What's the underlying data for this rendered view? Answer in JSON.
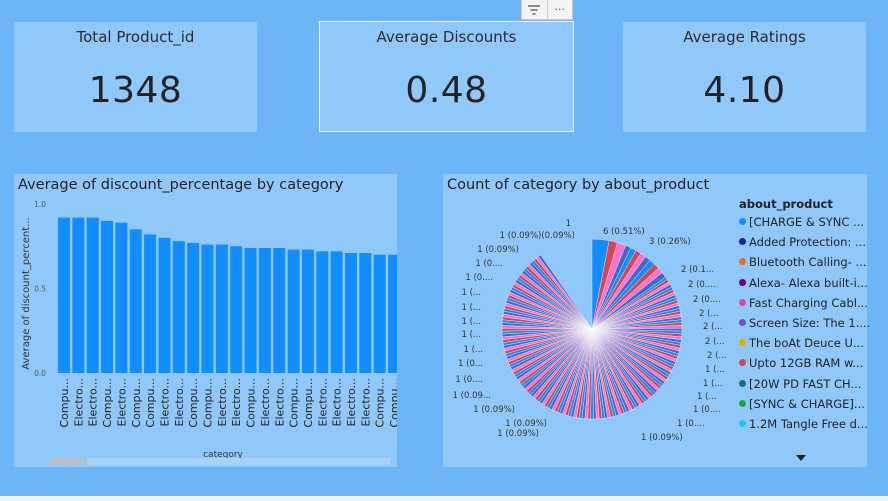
{
  "kpis": {
    "total": {
      "title": "Total Product_id",
      "value": "1348"
    },
    "discounts": {
      "title": "Average Discounts",
      "value": "0.48"
    },
    "ratings": {
      "title": "Average Ratings",
      "value": "4.10"
    }
  },
  "toolbar": {
    "filter_icon": "filter-icon",
    "more_icon": "more-options-icon",
    "more_glyph": "···"
  },
  "bar_chart": {
    "title": "Average of discount_percentage by category",
    "chart_data": {
      "type": "bar",
      "title": "Average of discount_percentage by category",
      "xlabel": "category",
      "ylabel": "Average of discount_percent...",
      "ylim": [
        0,
        1
      ],
      "yticks": [
        "0.0",
        "0.5",
        "1.0"
      ],
      "categories": [
        "Compu...",
        "Electro...",
        "Electro...",
        "Compu...",
        "Electro...",
        "Compu...",
        "Compu...",
        "Electro...",
        "Electro...",
        "Compu...",
        "Compu...",
        "Electro...",
        "Electro...",
        "Compu...",
        "Electro...",
        "Electro...",
        "Compu...",
        "Compu...",
        "Electro...",
        "Electro...",
        "Electro...",
        "Electro...",
        "Compu...",
        "Compu...",
        "Electro...",
        "Electro..."
      ],
      "values": [
        0.92,
        0.92,
        0.92,
        0.9,
        0.89,
        0.85,
        0.82,
        0.8,
        0.78,
        0.77,
        0.76,
        0.76,
        0.75,
        0.74,
        0.74,
        0.74,
        0.73,
        0.73,
        0.72,
        0.72,
        0.71,
        0.71,
        0.7,
        0.7,
        0.7,
        0.7
      ],
      "color": "#118dff"
    }
  },
  "pie_chart": {
    "title": "Count of category by about_product",
    "chart_data": {
      "type": "pie",
      "title": "Count of category by about_product",
      "legend_title": "about_product",
      "legend": [
        {
          "label": "[CHARGE & SYNC ...",
          "color": "#118dff"
        },
        {
          "label": "Added Protection: ...",
          "color": "#12239e"
        },
        {
          "label": "Bluetooth Calling- ...",
          "color": "#e66c37"
        },
        {
          "label": "Alexa- Alexa built-i...",
          "color": "#6b007b"
        },
        {
          "label": "Fast Charging Cabl...",
          "color": "#e044a7"
        },
        {
          "label": "Screen Size: The 1....",
          "color": "#744ec2"
        },
        {
          "label": "The boAt Deuce U...",
          "color": "#d9b300"
        },
        {
          "label": "Upto 12GB RAM w...",
          "color": "#d64550"
        },
        {
          "label": "[20W PD FAST CH...",
          "color": "#197278"
        },
        {
          "label": "[SYNC & CHARGE]...",
          "color": "#1aab40"
        },
        {
          "label": "1.2M Tangle Free d...",
          "color": "#15c6f4"
        }
      ],
      "data_labels": [
        "1",
        "6 (0.51%)",
        "3 (0.26%)",
        "2 (0.1...",
        "2 (0....",
        "2 (0....",
        "2 (...",
        "2 (...",
        "2 (...",
        "2 (...",
        "1 (...",
        "1 (...",
        "1 (...",
        "1 (0....",
        "1 (0....",
        "1 (0.09%)",
        "1 (0.09%)",
        "1 (0.09%)",
        "1 (0.09%)",
        "1 (0.09...",
        "1 (0....",
        "1 (0...",
        "1 (...",
        "1 (...",
        "1 (...",
        "1 (...",
        "1 (...",
        "1 (0....",
        "1 (0....",
        "1 (0.09%)",
        "1 (0.09%)(0.09%)"
      ],
      "series_note": "1348 slices"
    }
  }
}
